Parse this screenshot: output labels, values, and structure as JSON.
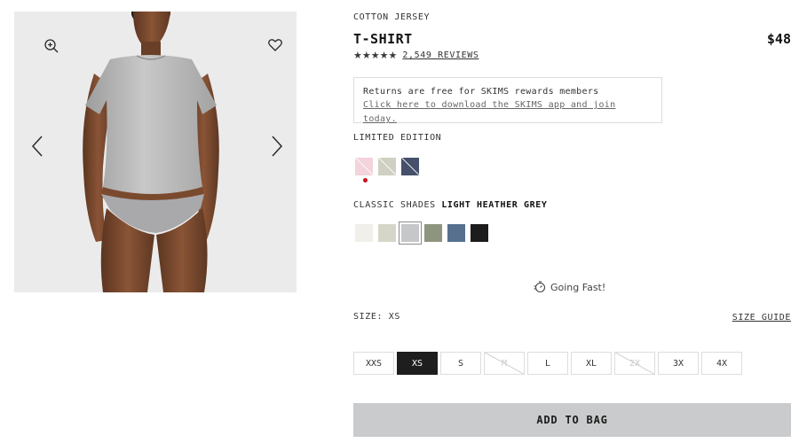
{
  "gallery": {
    "image_alt": "Model wearing grey cotton jersey t-shirt",
    "icons": {
      "zoom": "zoom-in-icon",
      "favorite": "heart-icon",
      "prev": "chevron-left-icon",
      "next": "chevron-right-icon"
    }
  },
  "product": {
    "category": "COTTON JERSEY",
    "title": "T-SHIRT",
    "price": "$48",
    "rating_stars": 5,
    "reviews_text": "2,549 REVIEWS"
  },
  "promo": {
    "line1": "Returns are free for SKIMS rewards members",
    "line2": "Click here to download the SKIMS app and join today."
  },
  "limited": {
    "label": "LIMITED EDITION",
    "swatches": [
      {
        "color": "#f3d3dc",
        "diag": true
      },
      {
        "color": "#cfd0c2",
        "diag": true
      },
      {
        "color": "#45506a",
        "diag": true
      }
    ]
  },
  "classic": {
    "label_prefix": "CLASSIC SHADES",
    "selected_name": "LIGHT HEATHER GREY",
    "swatches": [
      {
        "color": "#f0efea"
      },
      {
        "color": "#d6d6c8"
      },
      {
        "color": "#c5c7c9",
        "selected": true
      },
      {
        "color": "#8e957f"
      },
      {
        "color": "#56708e"
      },
      {
        "color": "#1c1c1c"
      }
    ]
  },
  "status": {
    "going_fast": "Going Fast!"
  },
  "size": {
    "label": "SIZE: XS",
    "guide": "SIZE GUIDE",
    "options": [
      {
        "label": "XXS",
        "state": "available"
      },
      {
        "label": "XS",
        "state": "selected"
      },
      {
        "label": "S",
        "state": "available"
      },
      {
        "label": "M",
        "state": "oos"
      },
      {
        "label": "L",
        "state": "available"
      },
      {
        "label": "XL",
        "state": "available"
      },
      {
        "label": "2X",
        "state": "oos"
      },
      {
        "label": "3X",
        "state": "available"
      },
      {
        "label": "4X",
        "state": "available"
      }
    ]
  },
  "cta": {
    "add_to_bag": "ADD TO BAG"
  }
}
